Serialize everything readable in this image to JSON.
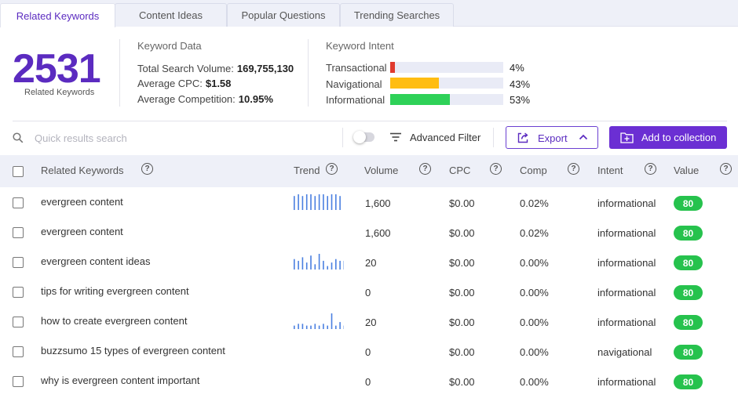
{
  "tabs": [
    {
      "label": "Related Keywords"
    },
    {
      "label": "Content Ideas"
    },
    {
      "label": "Popular Questions"
    },
    {
      "label": "Trending Searches"
    }
  ],
  "summary": {
    "count": "2531",
    "count_label": "Related Keywords",
    "keyword_data": {
      "title": "Keyword Data",
      "total_search_volume_label": "Total Search Volume:",
      "total_search_volume": "169,755,130",
      "avg_cpc_label": "Average CPC:",
      "avg_cpc": "$1.58",
      "avg_competition_label": "Average Competition:",
      "avg_competition": "10.95%"
    },
    "keyword_intent": {
      "title": "Keyword Intent",
      "items": [
        {
          "label": "Transactional",
          "pct": "4%",
          "value": 0.04,
          "color": "#e03a2e"
        },
        {
          "label": "Navigational",
          "pct": "43%",
          "value": 0.43,
          "color": "#ffbd12"
        },
        {
          "label": "Informational",
          "pct": "53%",
          "value": 0.53,
          "color": "#2ed158"
        }
      ]
    }
  },
  "toolbar": {
    "search_placeholder": "Quick results search",
    "advanced_filter": "Advanced Filter",
    "export": "Export",
    "add_to_collection": "Add to collection"
  },
  "table": {
    "headers": {
      "keyword": "Related Keywords",
      "trend": "Trend",
      "volume": "Volume",
      "cpc": "CPC",
      "comp": "Comp",
      "intent": "Intent",
      "value": "Value"
    },
    "rows": [
      {
        "keyword": "evergreen content",
        "trend": [
          8,
          9,
          8,
          9,
          9,
          8,
          9,
          9,
          8,
          9,
          9,
          8
        ],
        "volume": "1,600",
        "cpc": "$0.00",
        "comp": "0.02%",
        "intent": "informational",
        "value": "80"
      },
      {
        "keyword": "evergreen content",
        "trend": [],
        "volume": "1,600",
        "cpc": "$0.00",
        "comp": "0.02%",
        "intent": "informational",
        "value": "80"
      },
      {
        "keyword": "evergreen content ideas",
        "trend": [
          6,
          5,
          7,
          4,
          8,
          3,
          9,
          5,
          2,
          4,
          6,
          5,
          5,
          5
        ],
        "volume": "20",
        "cpc": "$0.00",
        "comp": "0.00%",
        "intent": "informational",
        "value": "80"
      },
      {
        "keyword": "tips for writing evergreen content",
        "trend": [],
        "volume": "0",
        "cpc": "$0.00",
        "comp": "0.00%",
        "intent": "informational",
        "value": "80"
      },
      {
        "keyword": "how to create evergreen content",
        "trend": [
          2,
          3,
          3,
          2,
          2,
          3,
          2,
          3,
          2,
          9,
          2,
          4,
          2,
          2
        ],
        "volume": "20",
        "cpc": "$0.00",
        "comp": "0.00%",
        "intent": "informational",
        "value": "80"
      },
      {
        "keyword": "buzzsumo 15 types of evergreen content",
        "trend": [],
        "volume": "0",
        "cpc": "$0.00",
        "comp": "0.00%",
        "intent": "navigational",
        "value": "80"
      },
      {
        "keyword": "why is evergreen content important",
        "trend": [],
        "volume": "0",
        "cpc": "$0.00",
        "comp": "0.00%",
        "intent": "informational",
        "value": "80"
      }
    ]
  },
  "colors": {
    "accent": "#5b2bc0",
    "value_badge": "#26c24d",
    "trend_bar": "#4a7fe0"
  }
}
